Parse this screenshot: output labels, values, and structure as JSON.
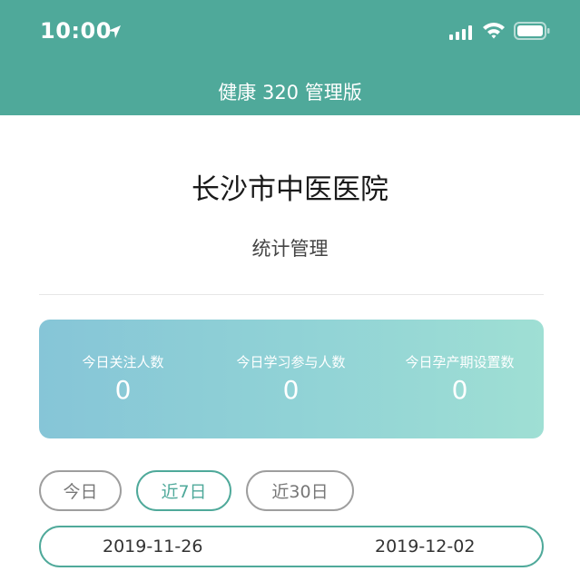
{
  "status_bar": {
    "time": "10:00"
  },
  "nav": {
    "title": "健康 320 管理版"
  },
  "header": {
    "hospital": "长沙市中医医院",
    "subtitle": "统计管理"
  },
  "stats": [
    {
      "label": "今日关注人数",
      "value": "0"
    },
    {
      "label": "今日学习参与人数",
      "value": "0"
    },
    {
      "label": "今日孕产期设置数",
      "value": "0"
    }
  ],
  "filters": [
    {
      "label": "今日",
      "active": false
    },
    {
      "label": "近7日",
      "active": true
    },
    {
      "label": "近30日",
      "active": false
    }
  ],
  "date_range": {
    "start": "2019-11-26",
    "end": "2019-12-02"
  },
  "colors": {
    "primary": "#4fa99a",
    "card_start": "#86c5d7",
    "card_end": "#9fdfd4"
  }
}
